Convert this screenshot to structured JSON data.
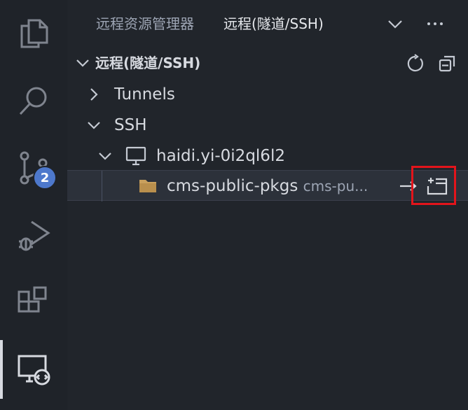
{
  "activity_bar": {
    "items": [
      {
        "name": "explorer",
        "icon": "files-icon"
      },
      {
        "name": "search",
        "icon": "search-icon"
      },
      {
        "name": "source-control",
        "icon": "source-control-icon",
        "badge": "2"
      },
      {
        "name": "run-debug",
        "icon": "run-debug-icon"
      },
      {
        "name": "extensions",
        "icon": "extensions-icon"
      },
      {
        "name": "remote-explorer",
        "icon": "remote-explorer-icon",
        "active": true
      }
    ]
  },
  "sidebar": {
    "tabs": [
      {
        "label": "远程资源管理器"
      },
      {
        "label": "远程(隧道/SSH)"
      }
    ],
    "section": {
      "title": "远程(隧道/SSH)"
    },
    "tree": {
      "tunnels_label": "Tunnels",
      "ssh_label": "SSH",
      "host_label": "haidi.yi-0i2ql6l2",
      "folder_label": "cms-public-pkgs",
      "folder_desc": "cms-pu..."
    }
  },
  "colors": {
    "accent_badge": "#4d78cc",
    "highlight": "#e3141b",
    "folder": "#c9a05d"
  }
}
